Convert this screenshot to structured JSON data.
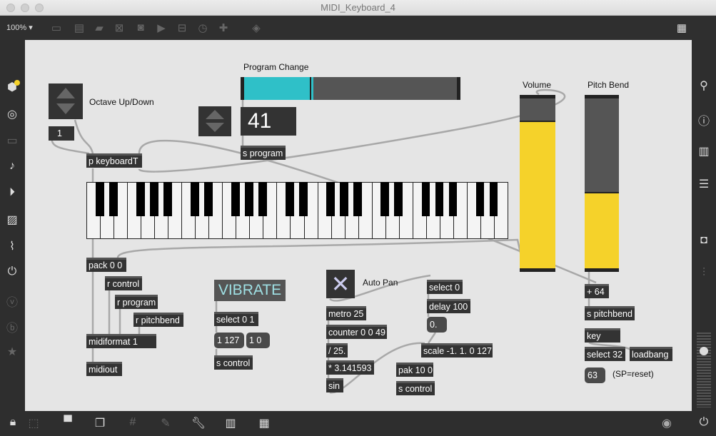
{
  "window": {
    "title": "MIDI_Keyboard_4",
    "zoom": "100%"
  },
  "toolbar": {
    "icons": [
      "presentation-icon",
      "message-icon",
      "comment-icon",
      "button-icon",
      "toggle-icon",
      "playbar-icon",
      "slider-icon",
      "dial-icon",
      "add-icon",
      "paint-bucket-icon"
    ]
  },
  "left_sidebar": {
    "icons": [
      "package-icon",
      "target-icon",
      "clipboard-icon",
      "music-note-icon",
      "video-icon",
      "image-icon",
      "paperclip-icon",
      "plug-icon",
      "v-icon",
      "b-icon",
      "star-icon"
    ]
  },
  "right_sidebar": {
    "icons": [
      "search-icon",
      "info-icon",
      "book-icon",
      "list-icon",
      "camera-icon",
      "mixer-icon"
    ]
  },
  "bottom_bar": {
    "icons": [
      "lock-icon",
      "select-icon",
      "presentation-icon",
      "layers-icon",
      "grid-icon",
      "clip-icon",
      "wrench-icon",
      "piano-icon",
      "keyboard-icon",
      "play-icon",
      "power-icon"
    ]
  },
  "colors": {
    "accent_cyan": "#2fc0c8",
    "slider_yellow": "#f5d22a",
    "object_bg": "#333333"
  },
  "patcher": {
    "comments": {
      "octave": "Octave Up/Down",
      "program": "Program Change",
      "volume": "Volume",
      "pitch": "Pitch Bend",
      "autopan": "Auto Pan",
      "reset": "(SP=reset)"
    },
    "octave_number": "1",
    "program_number": "41",
    "vibrate_label": "VIBRATE",
    "program_slider_fraction": 0.32,
    "volume_slider_fraction": 0.87,
    "pitch_slider_fraction": 0.45,
    "autopan_toggle": true,
    "keyboard": {
      "octaves": 4,
      "extra_white_keys": 3
    },
    "objects": [
      {
        "text": "p keyboardT",
        "kind": "obj"
      },
      {
        "text": "s program",
        "kind": "obj"
      },
      {
        "text": "pack 0 0",
        "kind": "obj"
      },
      {
        "text": "r control",
        "kind": "obj"
      },
      {
        "text": "r program",
        "kind": "obj"
      },
      {
        "text": "r pitchbend",
        "kind": "obj"
      },
      {
        "text": "midiformat 1",
        "kind": "obj"
      },
      {
        "text": "midiout",
        "kind": "obj"
      },
      {
        "text": "select 0 1",
        "kind": "obj"
      },
      {
        "text": "1 127",
        "kind": "msg"
      },
      {
        "text": "1 0",
        "kind": "msg"
      },
      {
        "text": "s control",
        "kind": "obj"
      },
      {
        "text": "metro 25",
        "kind": "obj"
      },
      {
        "text": "counter 0 0 49",
        "kind": "obj"
      },
      {
        "text": "/ 25.",
        "kind": "obj"
      },
      {
        "text": "* 3.141593",
        "kind": "obj"
      },
      {
        "text": "sin",
        "kind": "obj"
      },
      {
        "text": "select 0",
        "kind": "obj"
      },
      {
        "text": "delay 100",
        "kind": "obj"
      },
      {
        "text": "0.",
        "kind": "msg"
      },
      {
        "text": "scale -1. 1. 0 127",
        "kind": "obj"
      },
      {
        "text": "pak 10 0",
        "kind": "obj"
      },
      {
        "text": "s control",
        "kind": "obj"
      },
      {
        "text": "+ 64",
        "kind": "obj"
      },
      {
        "text": "s pitchbend",
        "kind": "obj"
      },
      {
        "text": "key",
        "kind": "obj"
      },
      {
        "text": "select 32",
        "kind": "obj"
      },
      {
        "text": "loadbang",
        "kind": "obj"
      },
      {
        "text": "63",
        "kind": "msg"
      }
    ]
  }
}
